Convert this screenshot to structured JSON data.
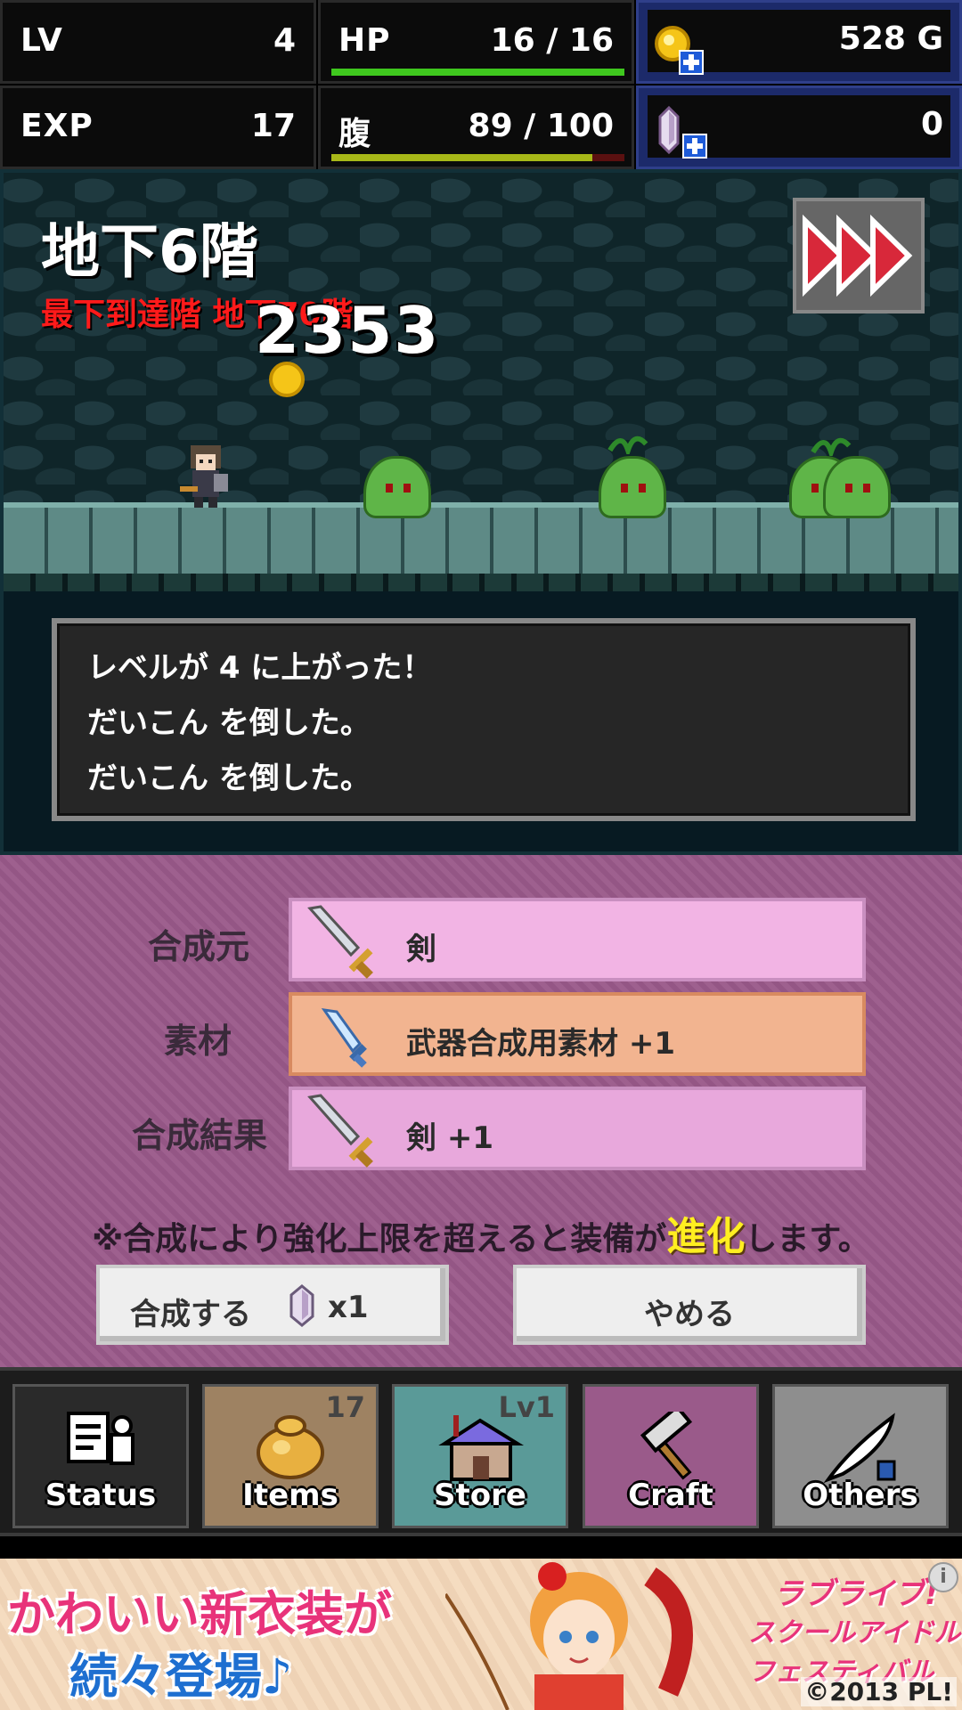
{
  "stats": {
    "lv_label": "LV",
    "lv_value": "4",
    "hp_label": "HP",
    "hp_value": "16 / 16",
    "hp_fraction": 1.0,
    "exp_label": "EXP",
    "exp_value": "17",
    "hunger_label": "腹",
    "hunger_value": "89 / 100",
    "hunger_fraction": 0.89,
    "gold_value": "528 G",
    "crystal_value": "0"
  },
  "dungeon": {
    "floor_name": "地下6階",
    "deepest_floor": "最下到達階 地下70階",
    "damage_number": "2353",
    "messages": [
      "レベルが 4 に上がった！",
      "だいこん を倒した。",
      "だいこん を倒した。"
    ]
  },
  "craft": {
    "base_label": "合成元",
    "base_item": "剣",
    "material_label": "素材",
    "material_item": "武器合成用素材 +1",
    "result_label": "合成結果",
    "result_item": "剣 +1",
    "note_before": "※合成により強化上限を超えると装備が",
    "note_highlight": "進化",
    "note_after": "します。",
    "confirm_label": "合成する",
    "confirm_cost": "x1",
    "cancel_label": "やめる"
  },
  "nav": {
    "status": {
      "label": "Status"
    },
    "items": {
      "label": "Items",
      "badge": "17"
    },
    "store": {
      "label": "Store",
      "badge": "Lv1"
    },
    "craft": {
      "label": "Craft"
    },
    "others": {
      "label": "Others"
    }
  },
  "ad": {
    "line1": "かわいい新衣装が",
    "line2": "続々登場♪",
    "brand1": "ラブライブ!",
    "brand2": "スクールアイドルフェスティバル",
    "copyright": "©2013 PL!"
  },
  "colors": {
    "hp_bar": "#3fc81e",
    "hunger_bar": "#a8b818",
    "craft_bg": "#9a5a8a",
    "highlight": "#ffee20",
    "deepest_red": "#ff1a1a"
  },
  "icons": [
    "coin-icon",
    "crystal-icon",
    "fast-forward-icon",
    "sword-icon",
    "crystal-dagger-icon",
    "status-icon",
    "bag-icon",
    "house-icon",
    "hammer-icon",
    "quill-icon",
    "info-icon"
  ]
}
